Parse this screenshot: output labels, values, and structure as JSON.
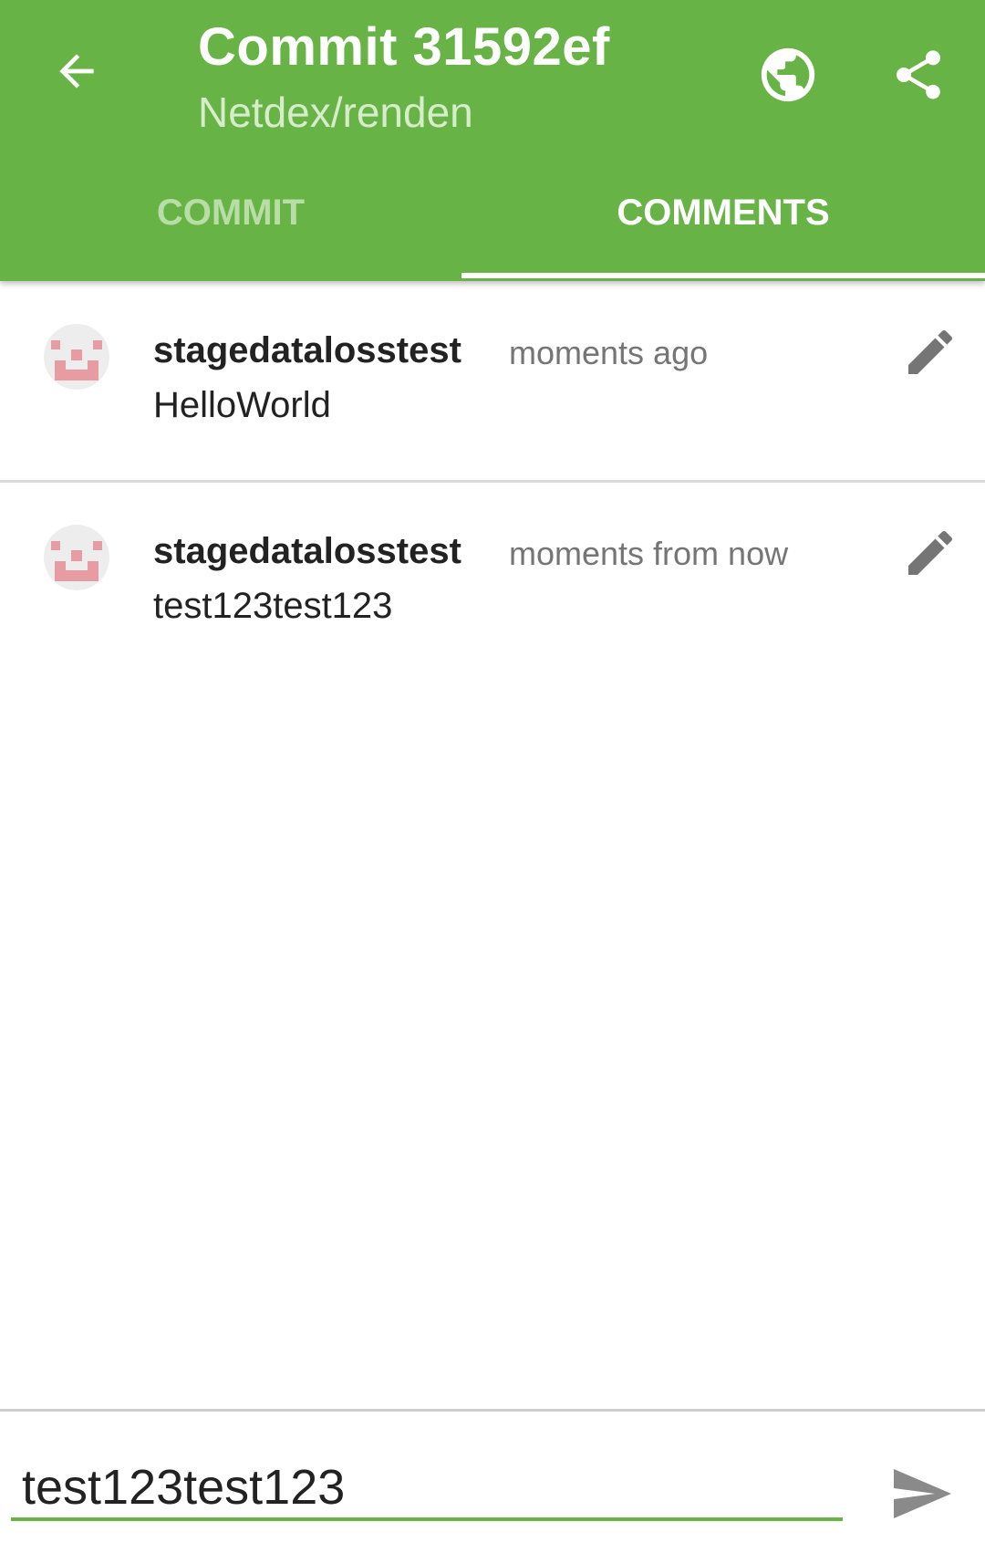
{
  "appbar": {
    "title": "Commit 31592ef",
    "subtitle": "Netdex/renden",
    "background_color": "#67b346",
    "icons": {
      "back": "arrow-back-icon",
      "browser": "globe-icon",
      "share": "share-icon"
    }
  },
  "tabs": [
    {
      "label": "COMMIT",
      "selected": false
    },
    {
      "label": "COMMENTS",
      "selected": true
    }
  ],
  "comments": [
    {
      "author": "stagedatalosstest",
      "time": "moments ago",
      "body": "HelloWorld",
      "edit_icon": "pencil-icon"
    },
    {
      "author": "stagedatalosstest",
      "time": "moments from now",
      "body": "test123test123",
      "edit_icon": "pencil-icon"
    }
  ],
  "composer": {
    "value": "test123test123",
    "send_icon": "send-icon",
    "accent_color": "#67b346"
  }
}
